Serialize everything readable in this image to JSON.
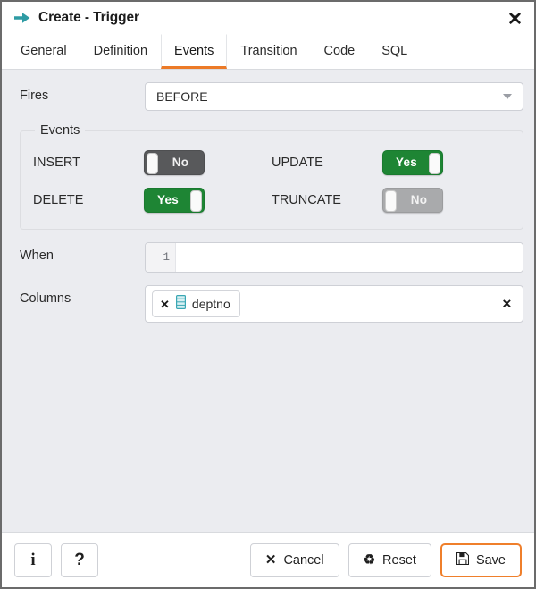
{
  "window": {
    "title": "Create - Trigger",
    "title_icon": "arrow-right-icon",
    "close_icon": "close-icon",
    "accent_color": "#ec7a27",
    "icon_color": "#2e9ba4",
    "background_color": "#ebecf0"
  },
  "tabs": [
    {
      "label": "General",
      "active": false
    },
    {
      "label": "Definition",
      "active": false
    },
    {
      "label": "Events",
      "active": true
    },
    {
      "label": "Transition",
      "active": false
    },
    {
      "label": "Code",
      "active": false
    },
    {
      "label": "SQL",
      "active": false
    }
  ],
  "form": {
    "fires": {
      "label": "Fires",
      "value": "BEFORE",
      "caret_icon": "chevron-down-icon"
    },
    "events": {
      "legend": "Events",
      "items": [
        {
          "label": "INSERT",
          "value": "No",
          "state": "off",
          "disabled": false
        },
        {
          "label": "UPDATE",
          "value": "Yes",
          "state": "on",
          "disabled": false
        },
        {
          "label": "DELETE",
          "value": "Yes",
          "state": "on",
          "disabled": false
        },
        {
          "label": "TRUNCATE",
          "value": "No",
          "state": "off",
          "disabled": true
        }
      ]
    },
    "when": {
      "label": "When",
      "line_number": "1",
      "value": "",
      "placeholder": ""
    },
    "columns": {
      "label": "Columns",
      "tokens": [
        {
          "label": "deptno",
          "icon": "column-icon",
          "remove_icon": "close-icon"
        }
      ],
      "clear_icon": "close-icon",
      "placeholder": ""
    }
  },
  "footer": {
    "info_label": "i",
    "help_label": "?",
    "cancel_label": "Cancel",
    "reset_label": "Reset",
    "save_label": "Save"
  }
}
